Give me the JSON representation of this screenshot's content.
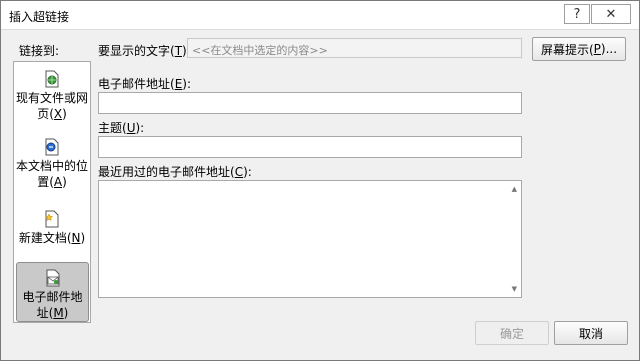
{
  "window": {
    "title": "插入超链接",
    "help_glyph": "?",
    "close_glyph": "✕"
  },
  "link_to": {
    "label": "链接到:",
    "items": [
      {
        "text": "现有文件或网页(",
        "key": "X",
        "tail": ")",
        "icon": "web-page-icon"
      },
      {
        "text": "本文档中的位置(",
        "key": "A",
        "tail": ")",
        "icon": "document-place-icon"
      },
      {
        "text": "新建文档(",
        "key": "N",
        "tail": ")",
        "icon": "new-document-icon"
      },
      {
        "text": "电子邮件地址(",
        "key": "M",
        "tail": ")",
        "icon": "email-icon",
        "selected": true
      }
    ]
  },
  "display_text": {
    "label_pre": "要显示的文字(",
    "label_key": "T",
    "label_post": "):",
    "placeholder": "<<在文档中选定的内容>>"
  },
  "screentip": {
    "pre": "屏幕提示(",
    "key": "P",
    "post": ")..."
  },
  "email_address": {
    "pre": "电子邮件地址(",
    "key": "E",
    "post": "):",
    "value": ""
  },
  "subject": {
    "pre": "主题(",
    "key": "U",
    "post": "):",
    "value": ""
  },
  "recent": {
    "pre": "最近用过的电子邮件地址(",
    "key": "C",
    "post": "):"
  },
  "buttons": {
    "ok": "确定",
    "cancel": "取消"
  },
  "colors": {
    "background": "#f0f0f0",
    "selected_nav": "#c9c9c9",
    "border": "#a9a9a9"
  }
}
